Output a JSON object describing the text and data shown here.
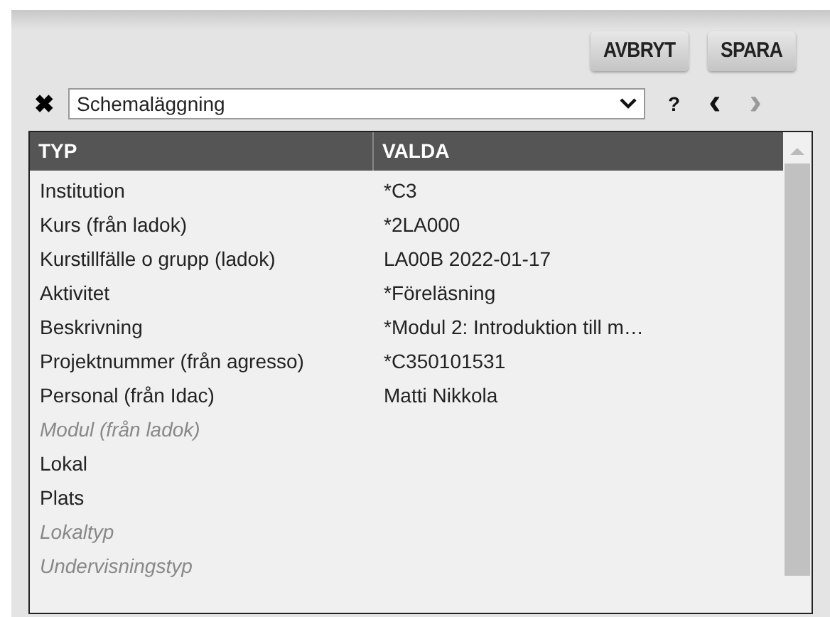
{
  "buttons": [
    {
      "label": "AVBRYT"
    },
    {
      "label": "SPARA"
    }
  ],
  "toolbar": {
    "close": "✖",
    "select_value": "Schemaläggning",
    "help": "?",
    "prev": {
      "label": "‹",
      "disabled": false
    },
    "next": {
      "label": "›",
      "disabled": true
    }
  },
  "table": {
    "columns": [
      "TYP",
      "VALDA"
    ],
    "rows": [
      {
        "type": "Institution",
        "value": "*C3",
        "disabled": false
      },
      {
        "type": "Kurs (från ladok)",
        "value": "*2LA000",
        "disabled": false
      },
      {
        "type": "Kurstillfälle o grupp (ladok)",
        "value": "LA00B 2022-01-17",
        "disabled": false
      },
      {
        "type": "Aktivitet",
        "value": "*Föreläsning",
        "disabled": false
      },
      {
        "type": "Beskrivning",
        "value": "*Modul 2: Introduktion till m…",
        "disabled": false
      },
      {
        "type": "Projektnummer (från agresso)",
        "value": "*C350101531",
        "disabled": false
      },
      {
        "type": "Personal (från Idac)",
        "value": "Matti Nikkola",
        "disabled": false
      },
      {
        "type": "Modul (från ladok)",
        "disabled": true
      },
      {
        "type": "Lokal",
        "disabled": false
      },
      {
        "type": "Plats",
        "disabled": false
      },
      {
        "type": "Lokaltyp",
        "disabled": true
      },
      {
        "type": "Undervisningstyp",
        "disabled": true
      }
    ]
  }
}
